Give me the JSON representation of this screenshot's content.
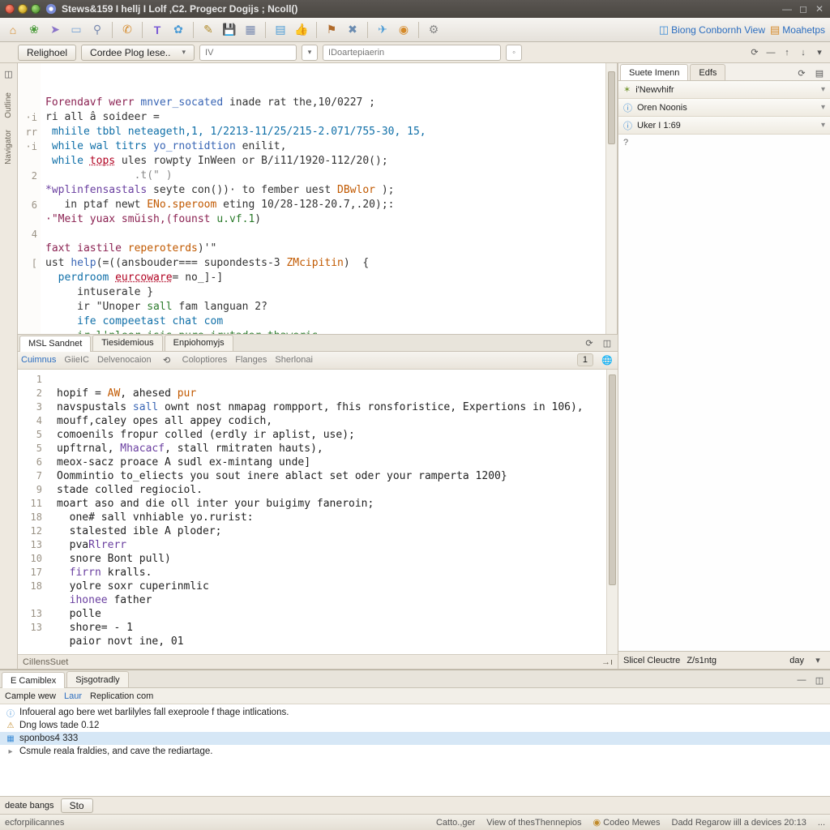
{
  "window": {
    "title": "Stews&159 I hellj I Lolf ,C2. Progecr Dogijs ; Ncoll()"
  },
  "toolbar_right": {
    "link1": "Biong Conbornh View",
    "link2": "Moahetps"
  },
  "crumbs": {
    "btn1": "Relighoel",
    "dropdown": "Cordee Plog Iese..",
    "input1": "IV",
    "input2": "IDoartepiaerin"
  },
  "side_tabs": {
    "tab1": "Suete Imenn",
    "tab2": "Edfs"
  },
  "side_rows": {
    "r1": "i'Newvhifr",
    "r2": "Oren Noonis",
    "r3": "Uker I 1:69"
  },
  "side_body": "?",
  "side_footer": {
    "left": "Slicel Cleuctre",
    "mid": "Z/s1ntg",
    "right": "day"
  },
  "editor1": {
    "gutter": [
      "",
      "·i",
      "rr",
      "·i",
      "",
      "2",
      "",
      "6",
      "",
      "4",
      "",
      "[",
      "",
      "",
      "",
      ""
    ],
    "line1_a": "Forendavf werr ",
    "line1_b": "mnver_socated",
    "line1_c": " inade rat the,10/0227 ;",
    "line2": "ri all â soideer =",
    "line3": " mhiile tbbl neteageth,1, 1/2213-11/25/215-2.071/755-30, 15,",
    "line4_a": " while wal titrs ",
    "line4_b": "yo_rnotidtion",
    "line4_c": " enilit,",
    "line5_a": " while ",
    "line5_b": "tops",
    "line5_c": " ules rowpty InWeen or B/i11/1920-112/20();",
    "line6": "              .t(\" )",
    "line7_a": "*",
    "line7_b": "wplinfensastals",
    "line7_c": " seyte con())· to fember uest ",
    "line7_d": "DBwlor",
    "line7_e": " );",
    "line8_a": "   in ptaf newt ",
    "line8_b": "ENo.speroom",
    "line8_c": " eting 10/28-128-20.7,.20);:",
    "line9_a": "·\"Meit yuax smŭish,(founst ",
    "line9_b": "u.vf.1",
    "line9_c": ")",
    "line10_a": "faxt iastile ",
    "line10_b": "reperoterds",
    "line10_c": ")'\"",
    "line11_a": "ust ",
    "line11_b": "help",
    "line11_c": "(=((ansbouder=== supondests-3 ",
    "line11_d": "ZMcipitin",
    "line11_e": ")  {",
    "line12_a": "  perdroom ",
    "line12_b": "eurcoware",
    "line12_c": "= no_]-]",
    "line13": "     intuserale }",
    "line14_a": "     ir \"Unoper ",
    "line14_b": "sall",
    "line14_c": " fam languan 2?",
    "line15": "     ife compeetast chat com",
    "line16": "     ir l'nleer isis pure irutader thaweris"
  },
  "mid_tabs": {
    "t1": "MSL Sandnet",
    "t2": "Tiesidemious",
    "t3": "Enpiohomyjs"
  },
  "sec_toolbar": {
    "i1": "Cuimnus",
    "i2": "GiieIC",
    "i3": "Delvenocaion",
    "i4": "Coloptiores",
    "i5": "Flanges",
    "i6": "Sherlonai",
    "right_badge": "1"
  },
  "editor2": {
    "gutter": [
      "1",
      "2",
      "3",
      "4",
      "5",
      "5",
      "6",
      "7",
      "9",
      "11",
      "18",
      "12",
      "13",
      "10",
      "17",
      "18",
      "",
      "13",
      "13"
    ],
    "l1_a": "hopif = ",
    "l1_b": "AW",
    "l1_c": ", ahesed ",
    "l1_d": "pur",
    "l2_a": "navspustals ",
    "l2_b": "sall",
    "l2_c": " ownt nost nmapag rompport, fhis ronsforistice, Expertions in 106),",
    "l3": "mouff,caley opes all appey codich,",
    "l4": "comoenils fropur colled (erdly ir aplist, use);",
    "l5_a": "upftrnal, ",
    "l5_b": "Mhacacf",
    "l5_c": ", stall rmitraten hauts),",
    "l6": "meox-sacz proace A sudl ex-mintang unde]",
    "l7": "Oommintio to_eliects you sout inere ablact set oder your ramperta 1200}",
    "l8": "stade colled regiociol.",
    "l9": "moart aso and die oll inter your buigimy faneroin;",
    "l10": "  one# sall vnhiable yo.rurist:",
    "l11": "  stalested ible A ploder;",
    "l12_a": "  pva",
    "l12_b": "Rlrerr",
    "l13": "  snore Bont pull)",
    "l14_a": "  ",
    "l14_b": "firrn",
    "l14_c": " kralls.",
    "l15": "  yolre soxr cuperinmlic",
    "l16_a": "  ",
    "l16_b": "ihonee",
    "l16_c": " father",
    "l17": "  polle",
    "l18": "  shore= - 1",
    "l19": "  paior novt ine, 01"
  },
  "stat_strip": {
    "left": "CiIlensSuet",
    "right": "→ı"
  },
  "console": {
    "tab1": "E Camiblex",
    "tab2": "Sjsgotradly",
    "bar1": "Cample wew",
    "bar2": "Laur",
    "bar3": "Replication com",
    "line1": "Infoueral ago bere wet barlilyles fall exeproole f thage intlications.",
    "line2": "Dng lows tade 0.12",
    "line3": "sponbos4 333",
    "line4": "Csmule reala fraldies, and cave the rediartage.",
    "bottom_left": "deate bangs",
    "bottom_btn": "Sto"
  },
  "status": {
    "left": "ecforpilicannes",
    "m1": "Catto.,ger",
    "m2": "View of thesThennepios",
    "m3": "Codeo Mewes",
    "m4": "Dadd Regarow iill a devices 20:13",
    "dots": "..."
  }
}
